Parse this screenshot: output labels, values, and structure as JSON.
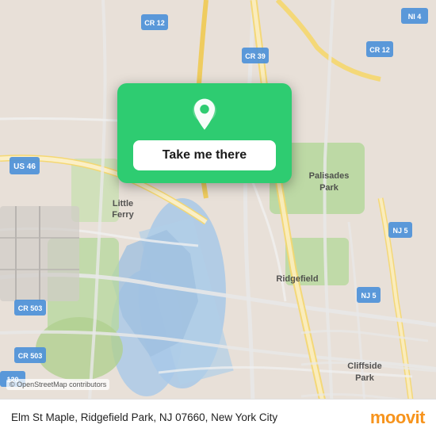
{
  "map": {
    "attribution": "© OpenStreetMap contributors"
  },
  "popup": {
    "button_label": "Take me there"
  },
  "bottom_bar": {
    "address": "Elm St Maple, Ridgefield Park, NJ 07660, New York City"
  },
  "moovit": {
    "brand": "moovit"
  }
}
